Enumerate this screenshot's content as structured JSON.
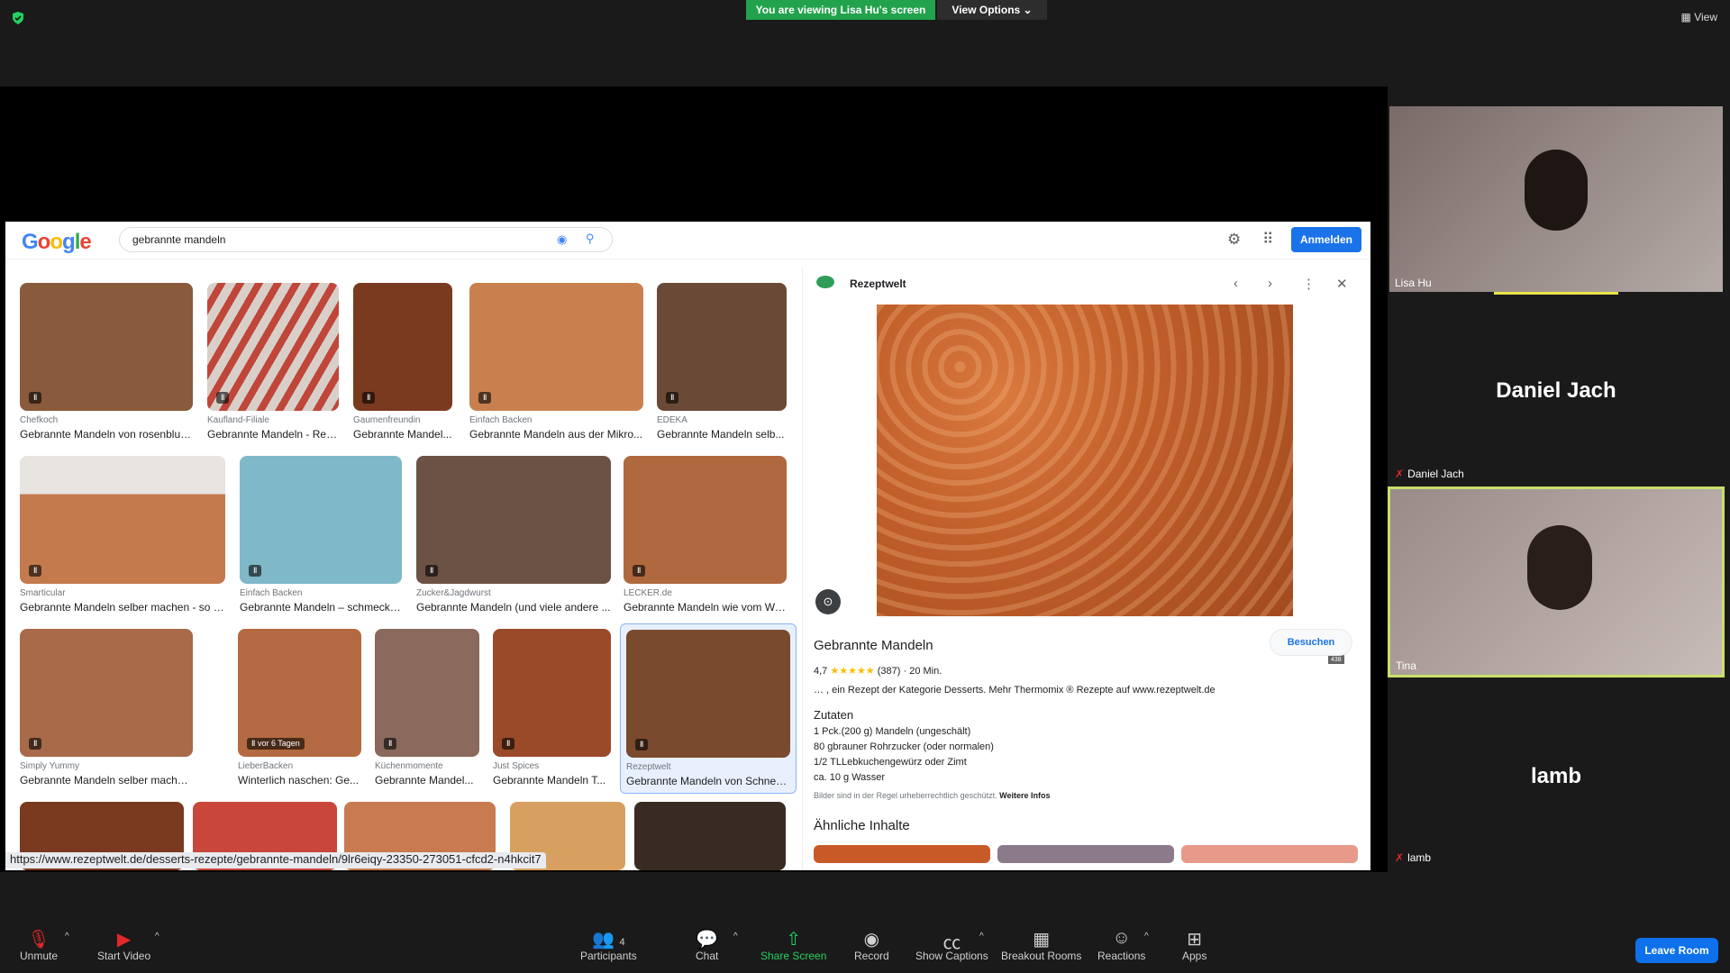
{
  "zoom": {
    "viewing_banner": "You are viewing Lisa Hu's screen",
    "view_options": "View Options ⌄",
    "view_label": "View",
    "participants": [
      {
        "name": "Lisa Hu"
      },
      {
        "name": "Daniel Jach",
        "big": "Daniel Jach"
      },
      {
        "name": "Tina"
      },
      {
        "name": "lamb",
        "big": "lamb"
      }
    ],
    "toolbar": {
      "unmute": "Unmute",
      "start_video": "Start Video",
      "participants_label": "Participants",
      "participants_count": "4",
      "chat": "Chat",
      "share_screen": "Share Screen",
      "record": "Record",
      "show_captions": "Show Captions",
      "breakout_rooms": "Breakout Rooms",
      "reactions": "Reactions",
      "apps": "Apps",
      "leave_room": "Leave Room"
    }
  },
  "google": {
    "logo": "Google",
    "query": "gebrannte mandeln",
    "signin": "Anmelden",
    "results": [
      {
        "src": "Chefkoch",
        "title": "Gebrannte Mandeln von rosenblue...",
        "color": "#8a5a3c"
      },
      {
        "src": "Kaufland-Filiale",
        "title": "Gebrannte Mandeln - Rez...",
        "color": "#b4583c"
      },
      {
        "src": "Gaumenfreundin",
        "title": "Gebrannte Mandel...",
        "color": "#7a3a1f"
      },
      {
        "src": "Einfach Backen",
        "title": "Gebrannte Mandeln aus der Mikro...",
        "color": "#c8814e"
      },
      {
        "src": "EDEKA",
        "title": "Gebrannte Mandeln selb...",
        "color": "#6a4a36"
      },
      {
        "src": "Smarticular",
        "title": "Gebrannte Mandeln selber machen - so g...",
        "color": "#c47a4d"
      },
      {
        "src": "Einfach Backen",
        "title": "Gebrannte Mandeln – schmecke...",
        "color": "#7fb8c8"
      },
      {
        "src": "Zucker&Jagdwurst",
        "title": "Gebrannte Mandeln (und viele andere ...",
        "color": "#6b5244"
      },
      {
        "src": "LECKER.de",
        "title": "Gebrannte Mandeln wie vom We...",
        "color": "#b0683f"
      },
      {
        "src": "Simply Yummy",
        "title": "Gebrannte Mandeln selber machen | Sim...",
        "color": "#a86a48"
      },
      {
        "src": "LieberBacken",
        "title": "Winterlich naschen: Ge...",
        "color": "#b46a40",
        "badge": "vor 6 Tagen"
      },
      {
        "src": "Küchenmomente",
        "title": "Gebrannte Mandel...",
        "color": "#8a6a5c"
      },
      {
        "src": "Just Spices",
        "title": "Gebrannte Mandeln T...",
        "color": "#9a4a28"
      },
      {
        "src": "Rezeptwelt",
        "title": "Gebrannte Mandeln von Schnec...",
        "color": "#7a4a2e"
      }
    ],
    "status_url": "https://www.rezeptwelt.de/desserts-rezepte/gebrannte-mandeln/9lr6eiqy-23350-273051-cfcd2-n4hkcit7",
    "panel": {
      "site": "Rezeptwelt",
      "dims": "565 × 438",
      "title": "Gebrannte Mandeln",
      "visit": "Besuchen",
      "rating": "4,7",
      "stars": "★★★★★",
      "reviews": "(387)",
      "time": "20 Min.",
      "desc": "… , ein Rezept der Kategorie Desserts. Mehr Thermomix ® Rezepte auf www.rezeptwelt.de",
      "ingredients_title": "Zutaten",
      "ingredients": [
        "1 Pck.(200 g) Mandeln (ungeschält)",
        "80 gbrauner Rohrzucker (oder normalen)",
        "1/2 TLLebkuchengewürz oder Zimt",
        "ca. 10 g Wasser"
      ],
      "note": "Bilder sind in der Regel urheberrechtlich geschützt.",
      "note_link": "Weitere Infos",
      "similar": "Ähnliche Inhalte"
    }
  }
}
